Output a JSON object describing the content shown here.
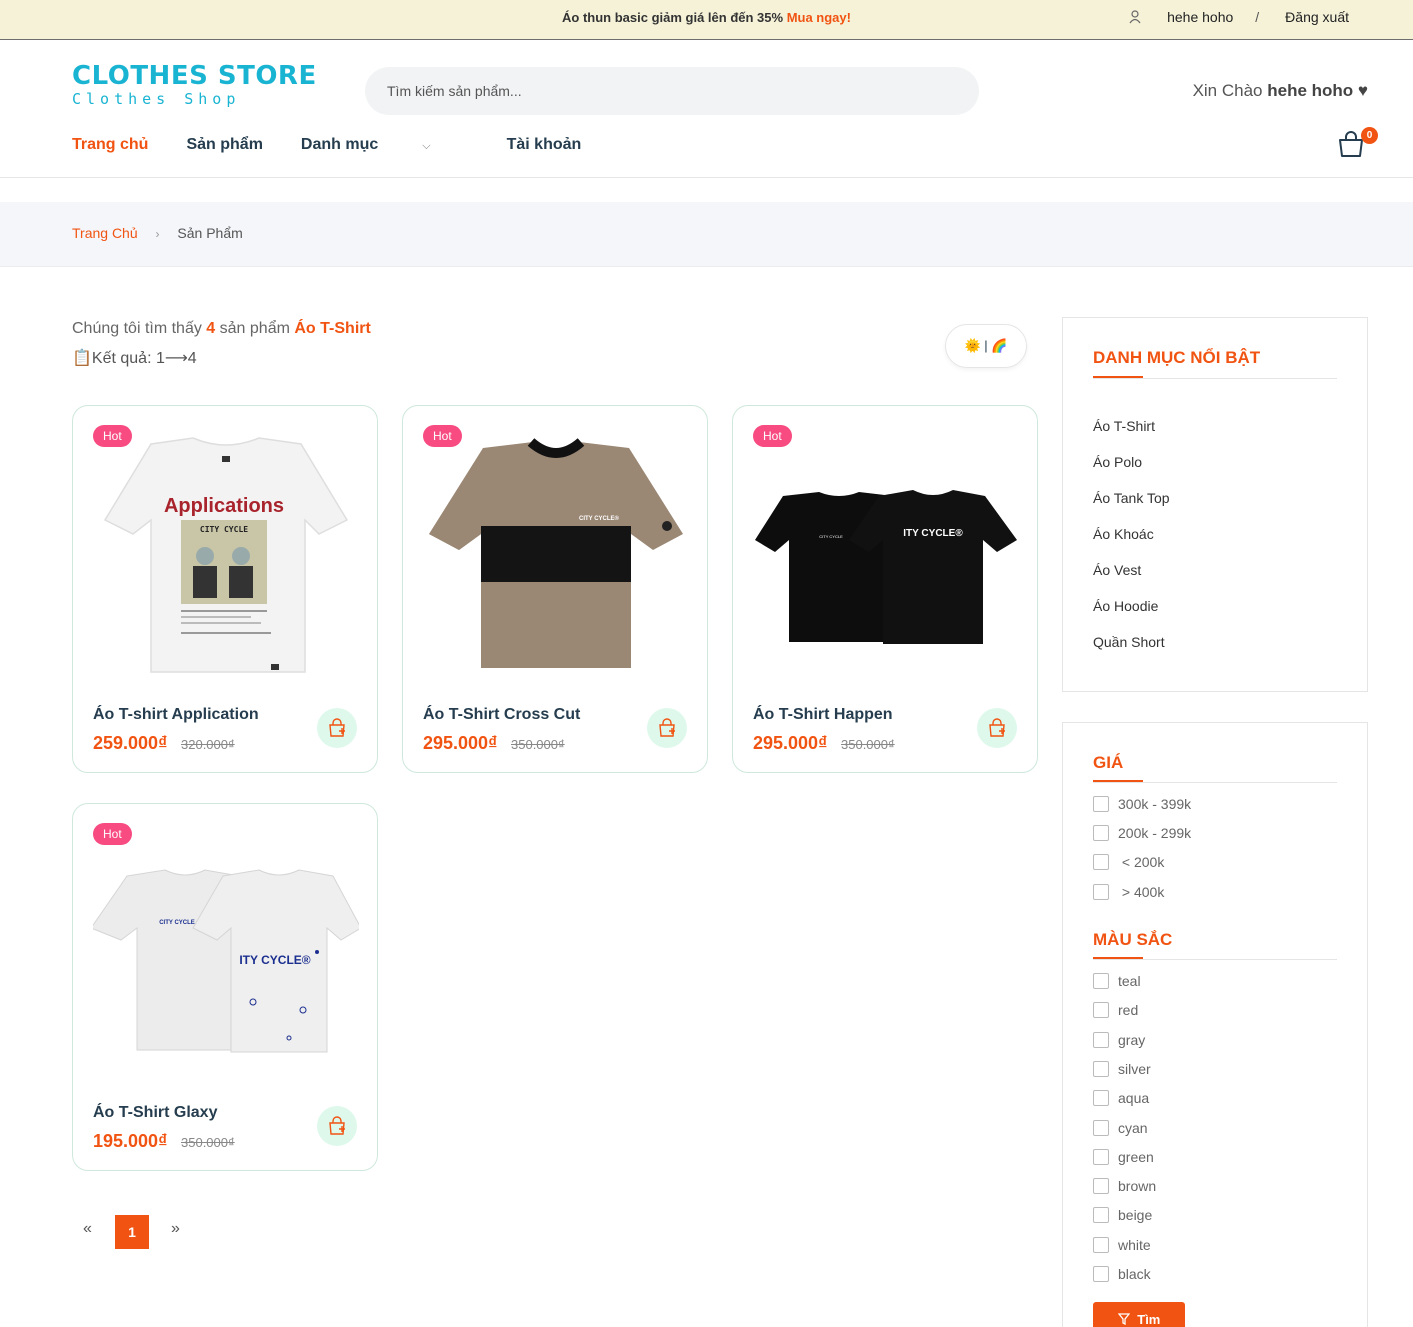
{
  "topbar": {
    "promo_text": "Áo thun basic giảm giá lên đến 35%",
    "promo_link": "Mua ngay!",
    "username": "hehe hoho",
    "separator": "/",
    "logout": "Đăng xuất"
  },
  "header": {
    "logo_top": "CLOTHES STORE",
    "logo_bottom": "Clothes Shop",
    "search_placeholder": "Tìm kiếm sản phẩm...",
    "greeting_prefix": "Xin Chào",
    "greeting_name": "hehe hoho ♥",
    "cart_count": "0"
  },
  "nav": {
    "home": "Trang chủ",
    "products": "Sản phẩm",
    "categories": "Danh mục",
    "account": "Tài khoản"
  },
  "breadcrumb": {
    "home": "Trang Chủ",
    "arrow": "›",
    "current": "Sản Phẩm"
  },
  "results": {
    "prefix": "Chúng tôi tìm thấy",
    "count": "4",
    "middle": "sản phẩm",
    "category": "Áo T-Shirt",
    "range": "📋Kết quả: 1⟶4",
    "toggle": "🌞 | 🌈"
  },
  "products": [
    {
      "badge": "Hot",
      "name": "Áo T-shirt Application",
      "price": "259.000₫",
      "old_price": "320.000₫"
    },
    {
      "badge": "Hot",
      "name": "Áo T-Shirt Cross Cut",
      "price": "295.000₫",
      "old_price": "350.000₫"
    },
    {
      "badge": "Hot",
      "name": "Áo T-Shirt Happen",
      "price": "295.000₫",
      "old_price": "350.000₫"
    },
    {
      "badge": "Hot",
      "name": "Áo T-Shirt Glaxy",
      "price": "195.000₫",
      "old_price": "350.000₫"
    }
  ],
  "product_art": {
    "app_title": "Applications",
    "app_sub": "CITY CYCLE",
    "cross_logo": "CITY CYCLE®",
    "happen_small": "CITY CYCLE",
    "happen_big": "ITY CYCLE®",
    "galaxy_small": "CITY CYCLE",
    "galaxy_big": "ITY CYCLE®"
  },
  "pagination": {
    "prev": "«",
    "current": "1",
    "next": "»"
  },
  "sidebar": {
    "featured_title": "DANH MỤC NỔI BẬT",
    "categories": [
      "Áo T-Shirt",
      "Áo Polo",
      "Áo Tank Top",
      "Áo Khoác",
      "Áo Vest",
      "Áo Hoodie",
      "Quần Short"
    ],
    "price_title": "GIÁ",
    "prices": [
      "300k - 399k",
      "200k - 299k",
      " < 200k",
      " > 400k"
    ],
    "color_title": "MÀU SẮC",
    "colors": [
      "teal",
      "red",
      "gray",
      "silver",
      "aqua",
      "cyan",
      "green",
      "brown",
      "beige",
      "white",
      "black"
    ],
    "search_button": "Tìm"
  },
  "colors": {
    "accent": "#f15412",
    "hot": "#f74b81",
    "logo": "#1ab4d3",
    "promo_bg": "#f5f2d8"
  }
}
